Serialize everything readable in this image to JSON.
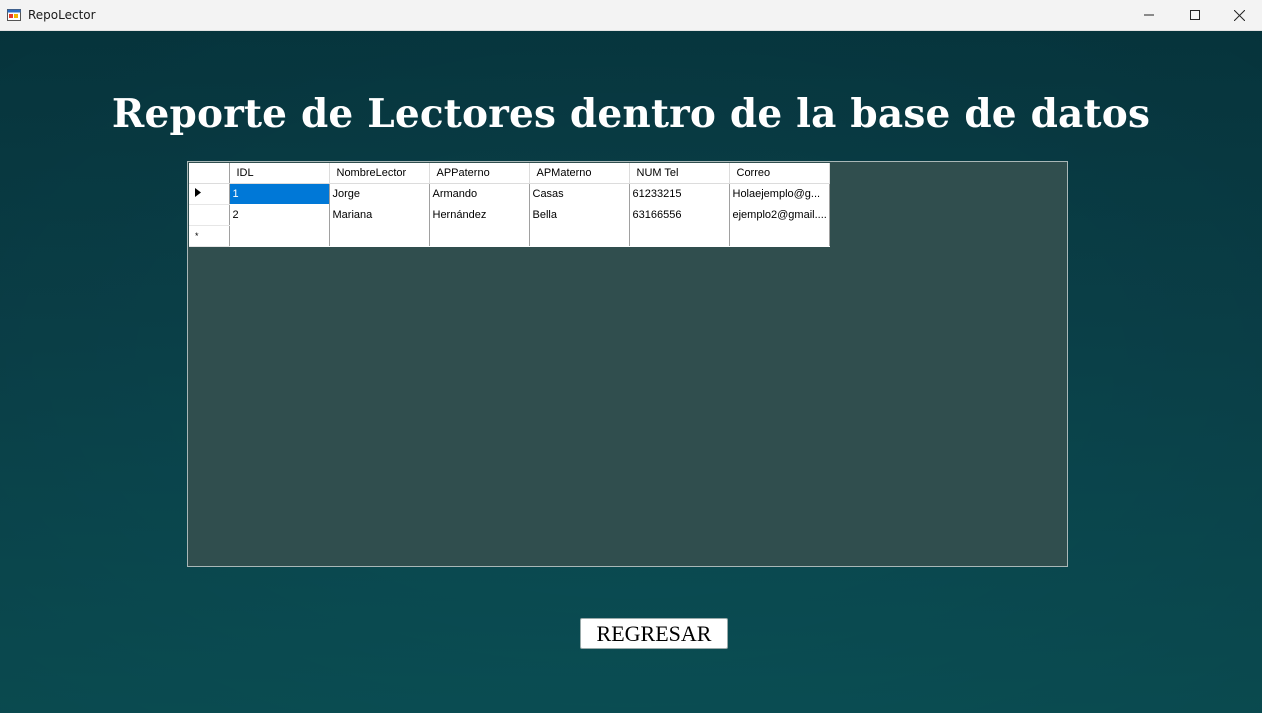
{
  "window": {
    "title": "RepoLector",
    "icon": "app-form-icon",
    "controls": [
      "minimize-icon",
      "maximize-icon",
      "close-icon"
    ]
  },
  "report": {
    "title": "Reporte de Lectores dentro de la base de datos"
  },
  "grid": {
    "columns": [
      "IDL",
      "NombreLector",
      "APPaterno",
      "APMaterno",
      "NUM Tel",
      "Correo"
    ],
    "rows": [
      {
        "cells": [
          "1",
          "Jorge",
          "Armando",
          "Casas",
          "61233215",
          "Holaejemplo@g..."
        ],
        "current": true
      },
      {
        "cells": [
          "2",
          "Mariana",
          "Hernández",
          "Bella",
          "63166556",
          "ejemplo2@gmail...."
        ],
        "current": false
      }
    ],
    "new_row_marker": "*",
    "current_row_marker": "▶",
    "selected_cell": "1"
  },
  "actions": {
    "back_label": "REGRESAR"
  },
  "colors": {
    "background": "#0b434c",
    "grid_area": "#304e4e",
    "selection": "#0078d7"
  }
}
